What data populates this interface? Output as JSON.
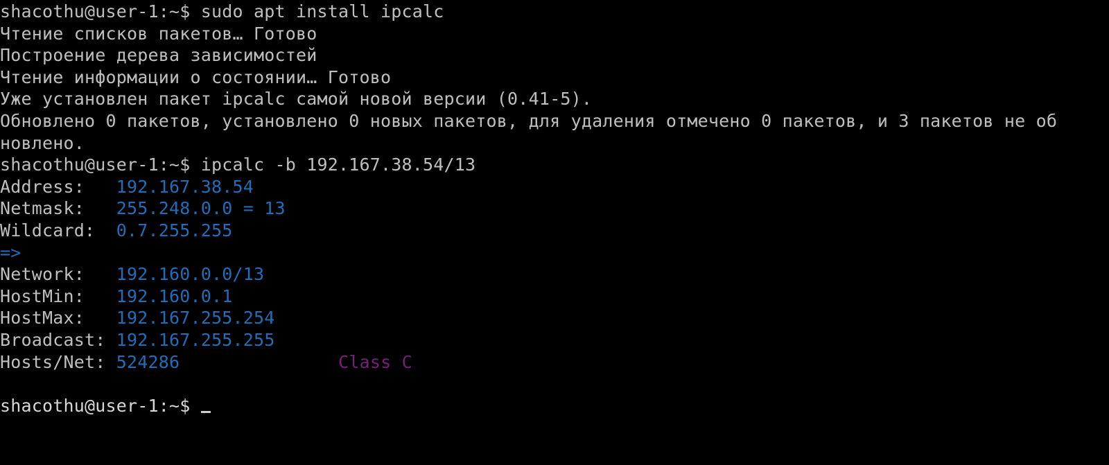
{
  "terminal": {
    "lines": {
      "l1": "shacothu@user-1:~$ sudo apt install ipcalc",
      "l2": "Чтение списков пакетов… Готово",
      "l3": "Построение дерева зависимостей",
      "l4": "Чтение информации о состоянии… Готово",
      "l5": "Уже установлен пакет ipcalc самой новой версии (0.41-5).",
      "l6": "Обновлено 0 пакетов, установлено 0 новых пакетов, для удаления отмечено 0 пакетов, и 3 пакетов не об",
      "l7": "новлено.",
      "l8": "shacothu@user-1:~$ ipcalc -b 192.167.38.54/13"
    },
    "ipcalc": {
      "address_label": "Address:   ",
      "address_value": "192.167.38.54",
      "netmask_label": "Netmask:   ",
      "netmask_value": "255.248.0.0 = 13",
      "wildcard_label": "Wildcard:  ",
      "wildcard_value": "0.7.255.255",
      "arrow": "=>",
      "network_label": "Network:   ",
      "network_value": "192.160.0.0/13",
      "hostmin_label": "HostMin:   ",
      "hostmin_value": "192.160.0.1",
      "hostmax_label": "HostMax:   ",
      "hostmax_value": "192.167.255.254",
      "broadcast_label": "Broadcast: ",
      "broadcast_value": "192.167.255.255",
      "hosts_label": "Hosts/Net: ",
      "hosts_value": "524286",
      "hosts_gap": "               ",
      "class_value": "Class C"
    },
    "final_prompt": "shacothu@user-1:~$ "
  },
  "colors": {
    "background": "#000000",
    "text": "#bfbfbf",
    "value": "#1f6fb8",
    "class": "#7b1e7b"
  }
}
